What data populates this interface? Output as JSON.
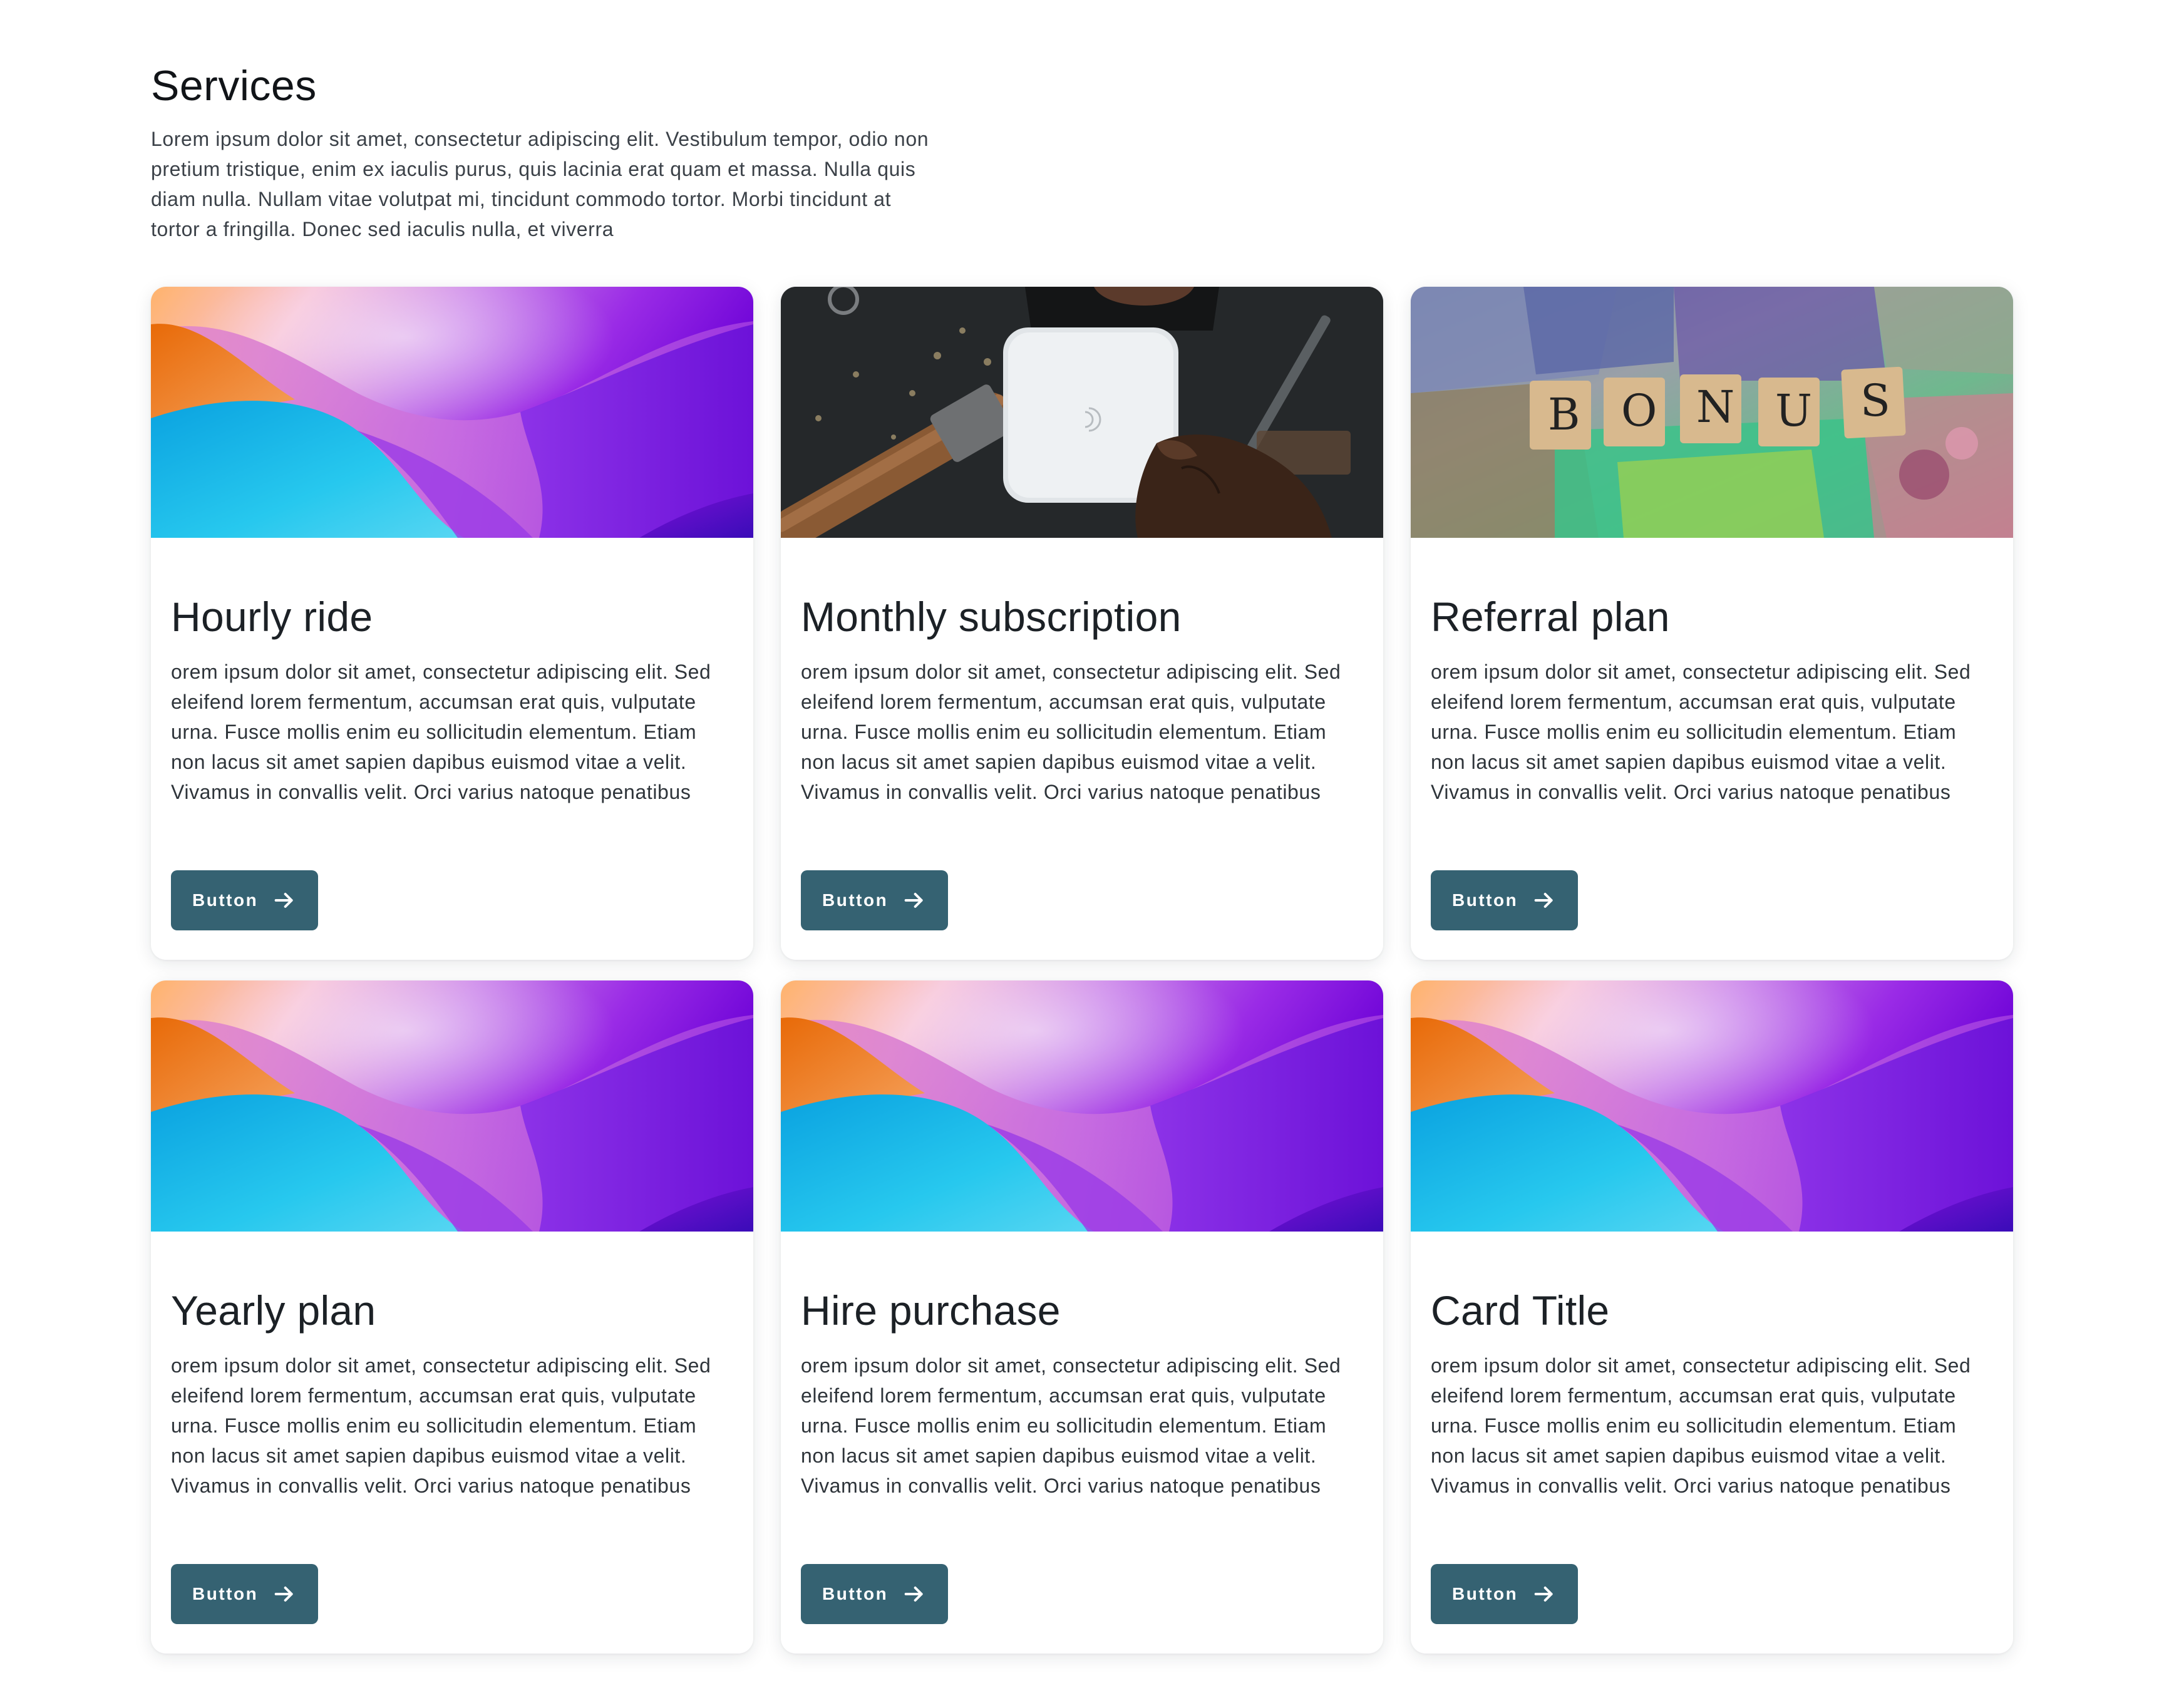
{
  "section": {
    "title": "Services",
    "description": "Lorem ipsum dolor sit amet, consectetur adipiscing elit. Vestibulum tempor, odio non pretium tristique, enim ex iaculis purus, quis lacinia erat quam et massa. Nulla quis diam nulla. Nullam vitae volutpat mi, tincidunt commodo tortor. Morbi tincidunt at tortor a fringilla. Donec sed iaculis nulla, et viverra"
  },
  "cards": [
    {
      "image": "gradient-wave",
      "title": "Hourly ride",
      "text": "orem ipsum dolor sit amet, consectetur adipiscing elit. Sed eleifend lorem fermentum, accumsan erat quis, vulputate urna. Fusce mollis enim eu sollicitudin elementum. Etiam non lacus sit amet sapien dapibus euismod vitae a velit. Vivamus in convallis velit. Orci varius natoque penatibus",
      "button_label": "Button"
    },
    {
      "image": "card-reader-photo",
      "title": "Monthly subscription",
      "text": "orem ipsum dolor sit amet, consectetur adipiscing elit. Sed eleifend lorem fermentum, accumsan erat quis, vulputate urna. Fusce mollis enim eu sollicitudin elementum. Etiam non lacus sit amet sapien dapibus euismod vitae a velit. Vivamus in convallis velit. Orci varius natoque penatibus",
      "button_label": "Button"
    },
    {
      "image": "bonus-tiles-photo",
      "image_letters": [
        "B",
        "O",
        "N",
        "U",
        "S"
      ],
      "title": "Referral plan",
      "text": "orem ipsum dolor sit amet, consectetur adipiscing elit. Sed eleifend lorem fermentum, accumsan erat quis, vulputate urna. Fusce mollis enim eu sollicitudin elementum. Etiam non lacus sit amet sapien dapibus euismod vitae a velit. Vivamus in convallis velit. Orci varius natoque penatibus",
      "button_label": "Button"
    },
    {
      "image": "gradient-wave",
      "title": "Yearly plan",
      "text": "orem ipsum dolor sit amet, consectetur adipiscing elit. Sed eleifend lorem fermentum, accumsan erat quis, vulputate urna. Fusce mollis enim eu sollicitudin elementum. Etiam non lacus sit amet sapien dapibus euismod vitae a velit. Vivamus in convallis velit. Orci varius natoque penatibus",
      "button_label": "Button"
    },
    {
      "image": "gradient-wave",
      "title": "Hire purchase",
      "text": "orem ipsum dolor sit amet, consectetur adipiscing elit. Sed eleifend lorem fermentum, accumsan erat quis, vulputate urna. Fusce mollis enim eu sollicitudin elementum. Etiam non lacus sit amet sapien dapibus euismod vitae a velit. Vivamus in convallis velit. Orci varius natoque penatibus",
      "button_label": "Button"
    },
    {
      "image": "gradient-wave",
      "title": "Card Title",
      "text": "orem ipsum dolor sit amet, consectetur adipiscing elit. Sed eleifend lorem fermentum, accumsan erat quis, vulputate urna. Fusce mollis enim eu sollicitudin elementum. Etiam non lacus sit amet sapien dapibus euismod vitae a velit. Vivamus in convallis velit. Orci varius natoque penatibus",
      "button_label": "Button"
    }
  ],
  "colors": {
    "button_bg": "#356272",
    "button_text": "#ffffff",
    "title_text": "#1c2126",
    "body_text": "#2e343a",
    "card_bg": "#ffffff"
  },
  "icons": {
    "button_icon": "arrow-right-icon"
  }
}
